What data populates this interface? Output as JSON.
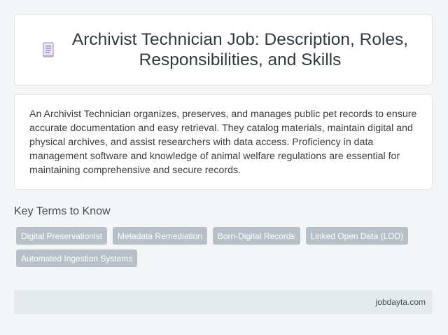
{
  "header": {
    "icon": "document-icon",
    "title": "Archivist Technician Job: Description, Roles, Responsibilities, and Skills"
  },
  "description": "An Archivist Technician organizes, preserves, and manages public pet records to ensure accurate documentation and easy retrieval. They catalog materials, maintain digital and physical archives, and assist researchers with data access. Proficiency in data management software and knowledge of animal welfare regulations are essential for maintaining comprehensive and secure records.",
  "key_terms": {
    "heading": "Key Terms to Know",
    "tags": [
      "Digital Preservationist",
      "Metadata Remediation",
      "Born-Digital Records",
      "Linked Open Data (LOD)",
      "Automated Ingestion Systems"
    ]
  },
  "footer": {
    "site": "jobdayta.com"
  },
  "colors": {
    "background": "#f3f5f6",
    "card": "#ffffff",
    "tag": "#b7c0c9",
    "footer": "#e5eaed",
    "icon": "#a79ac8"
  }
}
